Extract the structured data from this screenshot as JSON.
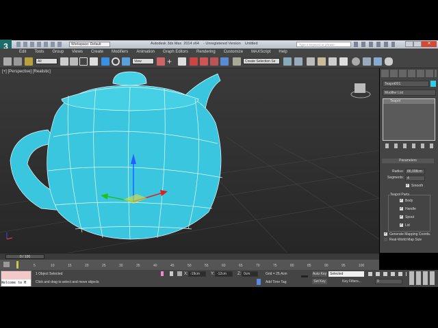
{
  "title": {
    "workspace": "Workspace: Default",
    "app_title": "Autodesk 3ds Max  2014 x64    - Unregistered Version    Untitled",
    "search_placeholder": "Type a keyword or phrase"
  },
  "menu": [
    "Edit",
    "Tools",
    "Group",
    "Views",
    "Create",
    "Modifiers",
    "Animation",
    "Graph Editors",
    "Rendering",
    "Customize",
    "MAXScript",
    "Help"
  ],
  "toolbar": {
    "filter": "All",
    "ref_coord": "View",
    "selection_set": "Create Selection Se"
  },
  "viewport": {
    "label": "[+] [Perspective] [Realistic]"
  },
  "command_panel": {
    "object_name": "Teapot001",
    "object_color": "#2fd0e6",
    "modifier_list": "Modifier List",
    "stack": [
      "Teapot"
    ],
    "rollout": "Parameters",
    "radius_label": "Radius:",
    "radius": "86,008cm",
    "segments_label": "Segments:",
    "segments": "4",
    "smooth": "Smooth",
    "parts_group": "Teapot Parts",
    "parts": [
      "Body",
      "Handle",
      "Spout",
      "Lid"
    ],
    "gen_mapping": "Generate Mapping Coords.",
    "real_world": "Real-World Map Size"
  },
  "timeline": {
    "frame": "0 / 100",
    "ticks": [
      "0",
      "5",
      "10",
      "15",
      "20",
      "25",
      "30",
      "35",
      "40",
      "45",
      "50",
      "55",
      "60",
      "65",
      "70",
      "75",
      "80",
      "85",
      "90",
      "95",
      "100"
    ]
  },
  "status": {
    "maxscript": "Welcome to M",
    "selected": "1 Object Selected",
    "prompt": "Click and drag to select and move objects",
    "x_label": "X:",
    "x": "-19cm",
    "y_label": "Y:",
    "y": "-12cm",
    "z_label": "Z:",
    "z": "0cm",
    "grid": "Grid = 25,4cm",
    "add_time_tag": "Add Time Tag",
    "auto_key": "Auto Key",
    "key_mode": "Selected",
    "set_key": "Set Key",
    "key_filters": "Key Filters...",
    "current_frame": "0"
  }
}
